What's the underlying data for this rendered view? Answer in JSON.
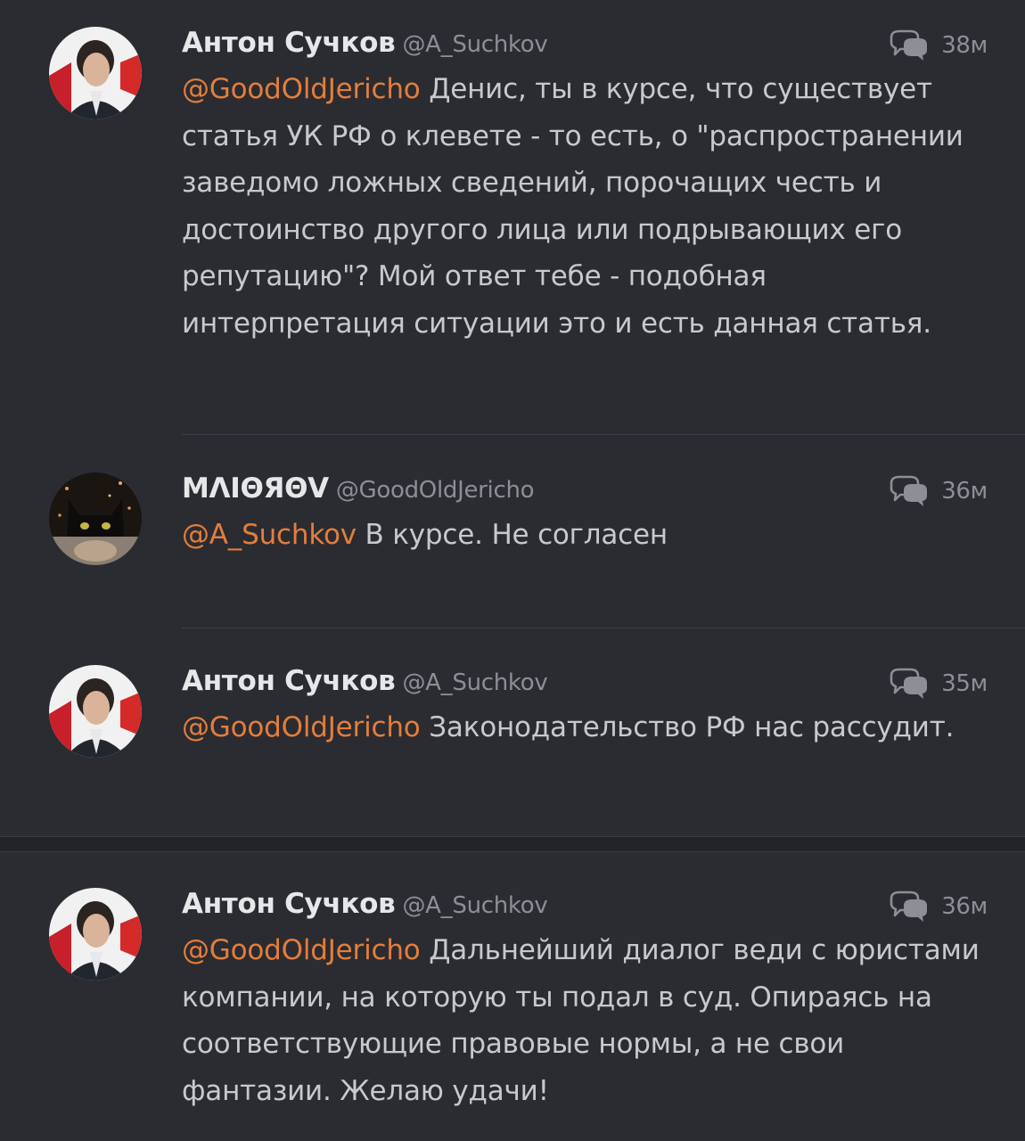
{
  "tweets": [
    {
      "name": "Антон Сучков",
      "handle": "@A_Suchkov",
      "time": "38м",
      "mention": "@GoodOldJericho",
      "text": " Денис, ты в курсе, что существует статья УК РФ о клевете - то есть, о \"распространении заведомо ложных сведений, порочащих честь и достоинство другого лица или подрывающих его репутацию\"?  Мой ответ тебе - подобная интерпретация ситуации это и есть данная статья.",
      "icon": "reply-bubbles-icon"
    },
    {
      "name": "MΛIΘЯΘV",
      "handle": "@GoodOldJericho",
      "time": "36м",
      "mention": "@A_Suchkov",
      "text": " В курсе. Не согласен",
      "icon": "reply-bubbles-icon"
    },
    {
      "name": "Антон Сучков",
      "handle": "@A_Suchkov",
      "time": "35м",
      "mention": "@GoodOldJericho",
      "text": " Законодательство РФ нас рассудит.",
      "icon": "reply-bubbles-icon"
    },
    {
      "name": "Антон Сучков",
      "handle": "@A_Suchkov",
      "time": "36м",
      "mention": "@GoodOldJericho",
      "text": " Дальнейший диалог веди с юристами компании, на которую ты подал в суд. Опираясь на соответствующие правовые нормы, а не свои фантазии. Желаю удачи!",
      "icon": "reply-bubbles-icon"
    }
  ],
  "colors": {
    "background": "#2a2c31",
    "mention": "#e47d3c",
    "name": "#e6e7e9",
    "secondary": "#8c8f95"
  }
}
